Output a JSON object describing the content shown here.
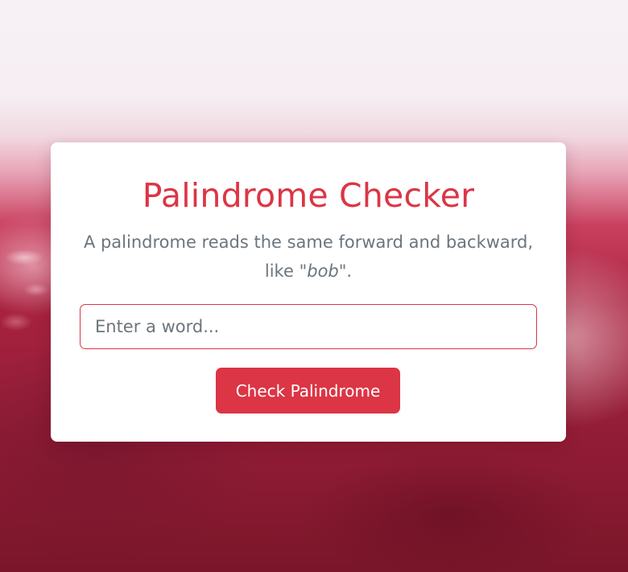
{
  "colors": {
    "accent": "#dc3545",
    "muted_text": "#6c757d",
    "card_background": "#ffffff"
  },
  "card": {
    "title": "Palindrome Checker",
    "description_prefix": "A palindrome reads the same forward and backward, like \"",
    "description_example": "bob",
    "description_suffix": "\"."
  },
  "input": {
    "placeholder": "Enter a word...",
    "value": ""
  },
  "button": {
    "label": "Check Palindrome"
  }
}
